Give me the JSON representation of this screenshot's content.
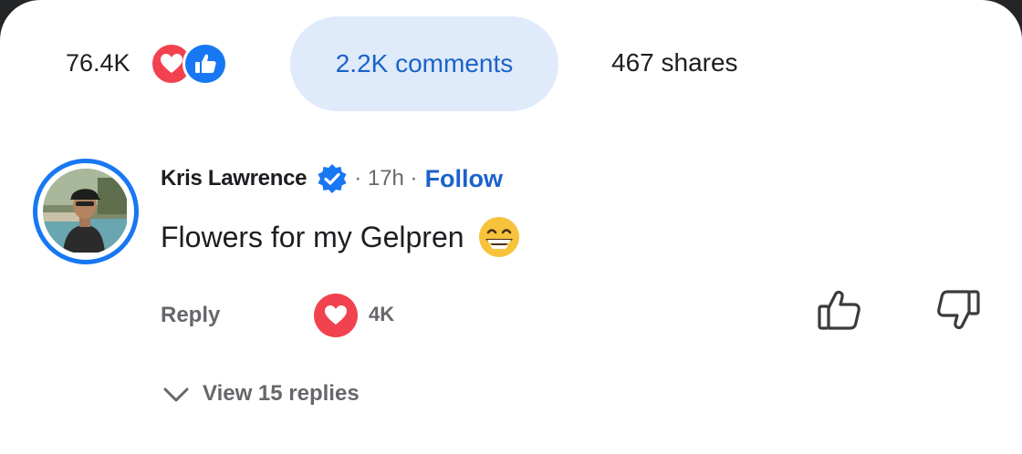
{
  "stats": {
    "reactions_count": "76.4K",
    "comments_label": "2.2K comments",
    "shares_label": "467 shares",
    "reaction_icons": [
      "heart-icon",
      "like-icon"
    ]
  },
  "comment": {
    "author": "Kris Lawrence",
    "verified": true,
    "time": "· 17h ·",
    "follow_label": "Follow",
    "text": "Flowers for my Gelpren",
    "emoji": "grinning-face-emoji",
    "reply_label": "Reply",
    "love_count": "4K",
    "view_replies_label": "View 15 replies"
  },
  "colors": {
    "accent": "#1877f2",
    "link": "#1a63c9",
    "love": "#f2424f",
    "pill_bg": "#dfeafa",
    "muted": "#65676b"
  }
}
